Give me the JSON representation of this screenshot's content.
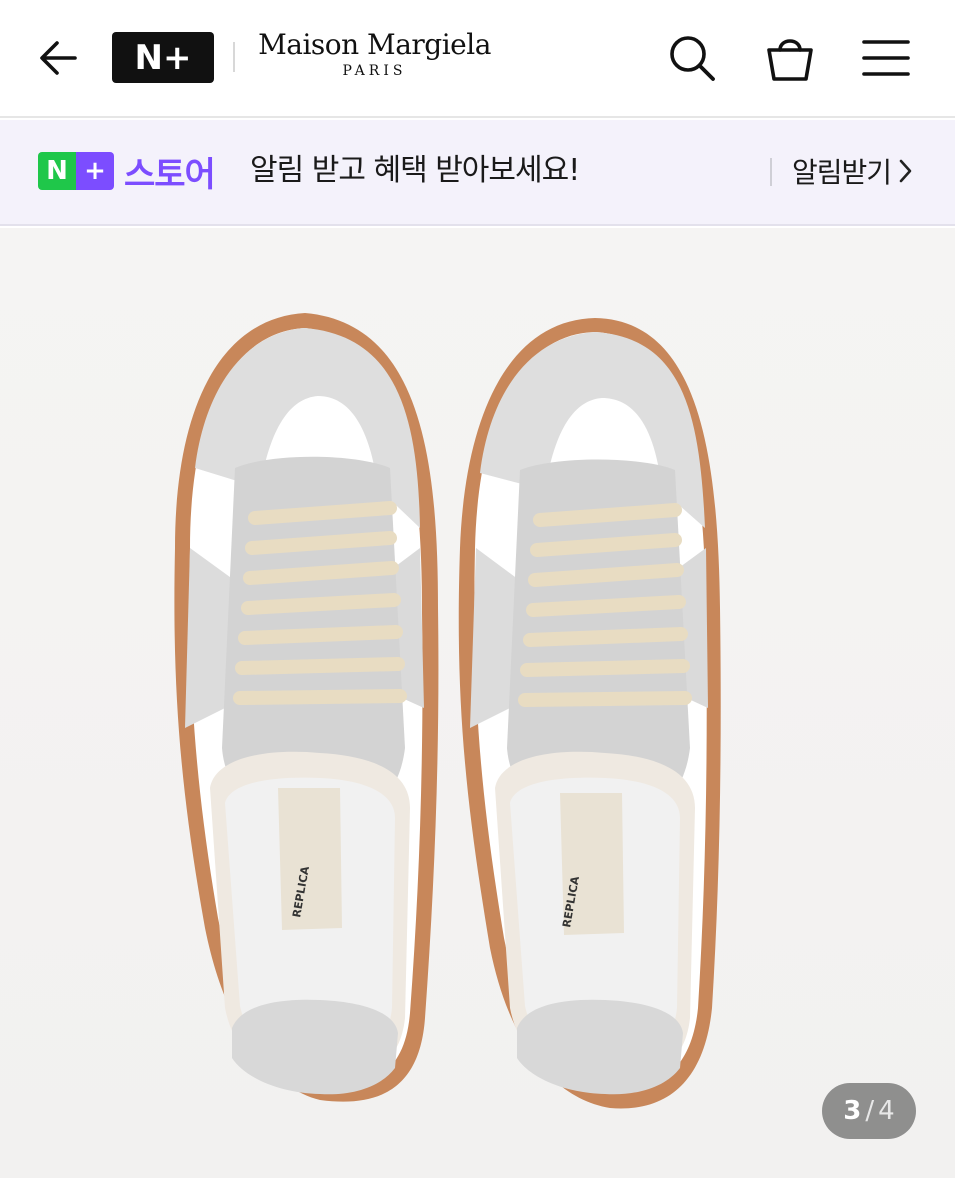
{
  "header": {
    "back_icon": "arrow-left-icon",
    "nplus_logo_text": "N+",
    "brand_name": "Maison Margiela",
    "brand_sub": "PARIS",
    "search_icon": "search-icon",
    "cart_icon": "shopping-basket-icon",
    "menu_icon": "hamburger-menu-icon"
  },
  "banner": {
    "store_badge_n": "N",
    "store_badge_plus": "+",
    "store_label": "스토어",
    "message": "알림 받고 혜택 받아보세요!",
    "action_label": "알림받기",
    "action_icon": "chevron-right-icon",
    "colors": {
      "green": "#1fc74a",
      "purple": "#7c4dff",
      "background": "#f4f2fb"
    }
  },
  "product_image": {
    "insole_text": "REPLICA",
    "pager": {
      "current": "3",
      "separator": "/",
      "total": "4"
    }
  }
}
